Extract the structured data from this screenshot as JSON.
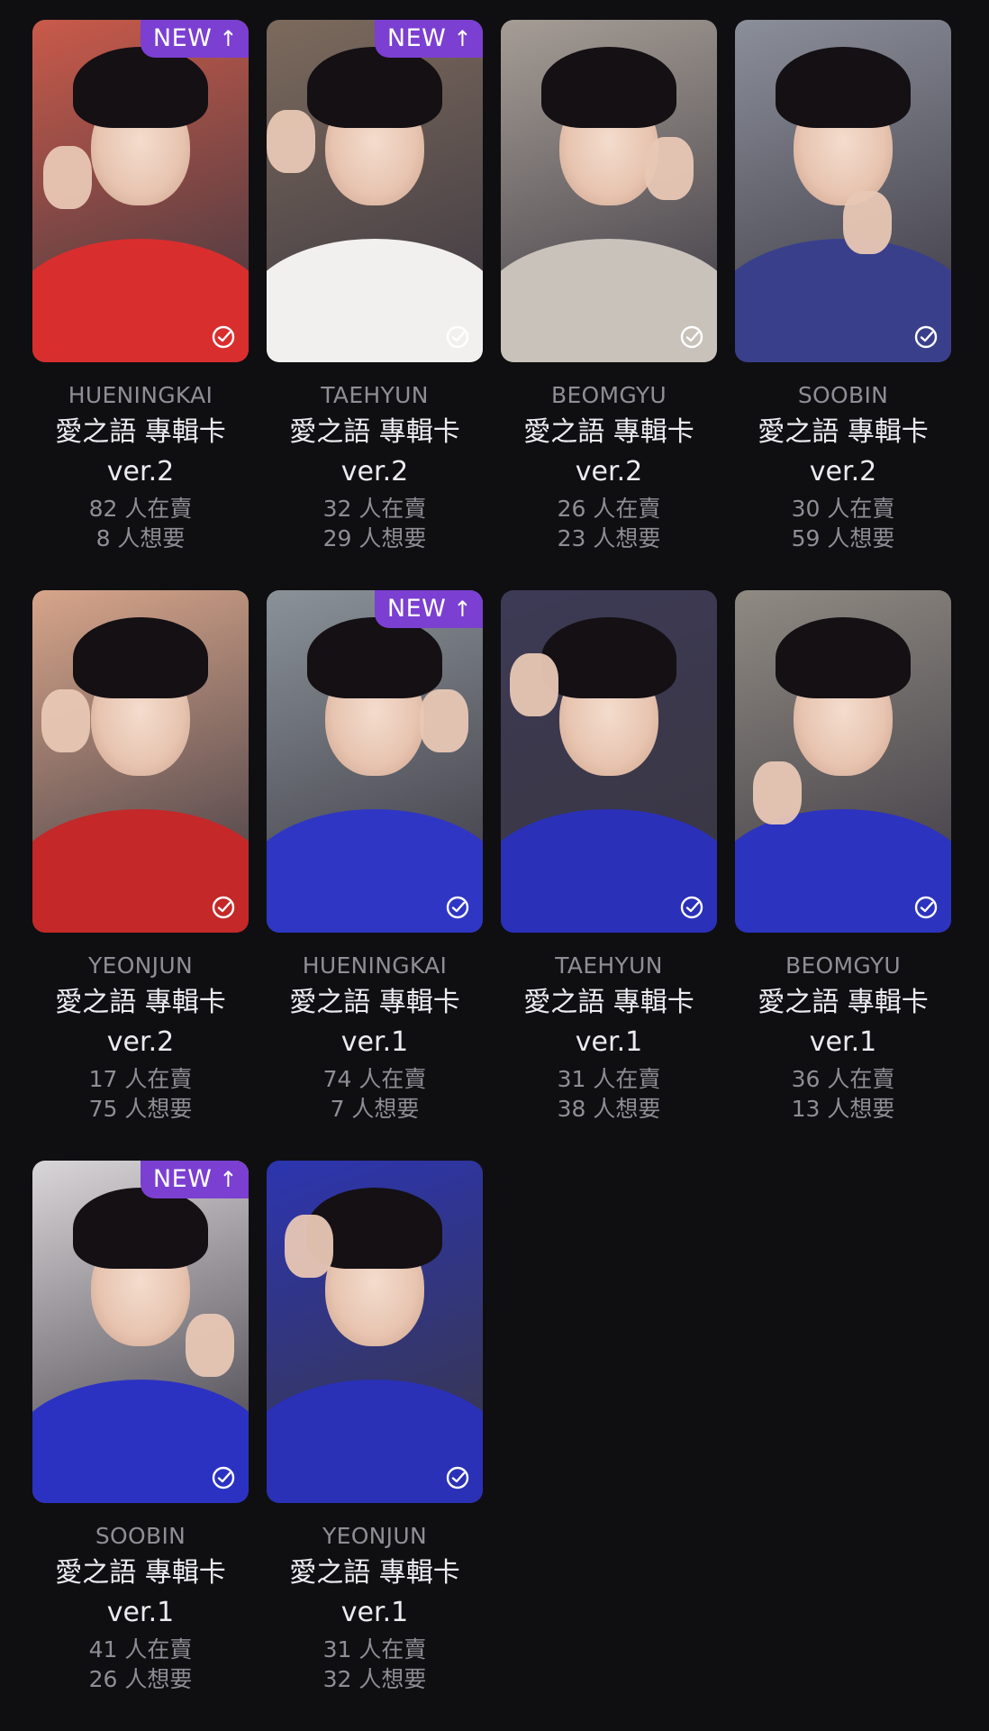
{
  "cards": [
    {
      "member": "HUENINGKAI",
      "title": "愛之語 專輯卡",
      "version": "ver.2",
      "selling": "82 人在賣",
      "wanting": "8 人想要",
      "is_new": true,
      "new_label": "NEW",
      "bg": "#c95a4a",
      "shirt": "#d92e2e"
    },
    {
      "member": "TAEHYUN",
      "title": "愛之語 專輯卡",
      "version": "ver.2",
      "selling": "32 人在賣",
      "wanting": "29 人想要",
      "is_new": true,
      "new_label": "NEW",
      "bg": "#7c6a5c",
      "shirt": "#f2f0ee"
    },
    {
      "member": "BEOMGYU",
      "title": "愛之語 專輯卡",
      "version": "ver.2",
      "selling": "26 人在賣",
      "wanting": "23 人想要",
      "is_new": false,
      "new_label": "",
      "bg": "#a59d95",
      "shirt": "#c9c2bb"
    },
    {
      "member": "SOOBIN",
      "title": "愛之語 專輯卡",
      "version": "ver.2",
      "selling": "30 人在賣",
      "wanting": "59 人想要",
      "is_new": false,
      "new_label": "",
      "bg": "#8b8f9a",
      "shirt": "#3a3f8c"
    },
    {
      "member": "YEONJUN",
      "title": "愛之語 專輯卡",
      "version": "ver.2",
      "selling": "17 人在賣",
      "wanting": "75 人想要",
      "is_new": false,
      "new_label": "",
      "bg": "#d7a58a",
      "shirt": "#c42828"
    },
    {
      "member": "HUENINGKAI",
      "title": "愛之語 專輯卡",
      "version": "ver.1",
      "selling": "74 人在賣",
      "wanting": "7 人想要",
      "is_new": true,
      "new_label": "NEW",
      "bg": "#8a9298",
      "shirt": "#2f36c4"
    },
    {
      "member": "TAEHYUN",
      "title": "愛之語 專輯卡",
      "version": "ver.1",
      "selling": "31 人在賣",
      "wanting": "38 人想要",
      "is_new": false,
      "new_label": "",
      "bg": "#3c3a55",
      "shirt": "#2a30b8"
    },
    {
      "member": "BEOMGYU",
      "title": "愛之語 專輯卡",
      "version": "ver.1",
      "selling": "36 人在賣",
      "wanting": "13 人想要",
      "is_new": false,
      "new_label": "",
      "bg": "#8f8a82",
      "shirt": "#2c33bf"
    },
    {
      "member": "SOOBIN",
      "title": "愛之語 專輯卡",
      "version": "ver.1",
      "selling": "41 人在賣",
      "wanting": "26 人想要",
      "is_new": true,
      "new_label": "NEW",
      "bg": "#d9d6d8",
      "shirt": "#2b32c2"
    },
    {
      "member": "YEONJUN",
      "title": "愛之語 專輯卡",
      "version": "ver.1",
      "selling": "31 人在賣",
      "wanting": "32 人想要",
      "is_new": false,
      "new_label": "",
      "bg": "#2c35b0",
      "shirt": "#2a31b6"
    }
  ],
  "colors": {
    "background": "#0f0f12",
    "badge": "#7b3fd1",
    "muted_text": "#8e8e95",
    "primary_text": "#ececf0"
  },
  "icons": {
    "owned": "check-circle-icon",
    "new_arrow": "arrow-up-icon"
  }
}
